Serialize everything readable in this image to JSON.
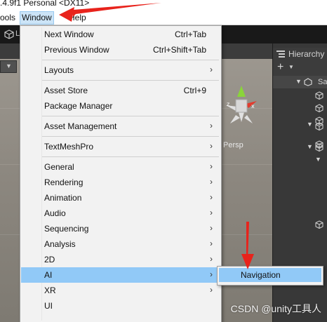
{
  "titlebar": {
    "text": ".4.9f1 Personal <DX11>"
  },
  "menubar": {
    "tools_label": "ools",
    "window_label": "Window",
    "help_label": "Help"
  },
  "editor": {
    "tab_label": "L",
    "scene_label": "Persp",
    "hierarchy_title": "Hierarchy",
    "hierarchy_plus": "+",
    "scene_row_label": "Sa"
  },
  "menu": {
    "items": [
      {
        "label": "Next Window",
        "shortcut": "Ctrl+Tab",
        "submenu": false
      },
      {
        "label": "Previous Window",
        "shortcut": "Ctrl+Shift+Tab",
        "submenu": false
      },
      {
        "label": "Layouts",
        "shortcut": "",
        "submenu": true
      },
      {
        "label": "Asset Store",
        "shortcut": "Ctrl+9",
        "submenu": false
      },
      {
        "label": "Package Manager",
        "shortcut": "",
        "submenu": false
      },
      {
        "label": "Asset Management",
        "shortcut": "",
        "submenu": true
      },
      {
        "label": "TextMeshPro",
        "shortcut": "",
        "submenu": true
      },
      {
        "label": "General",
        "shortcut": "",
        "submenu": true
      },
      {
        "label": "Rendering",
        "shortcut": "",
        "submenu": true
      },
      {
        "label": "Animation",
        "shortcut": "",
        "submenu": true
      },
      {
        "label": "Audio",
        "shortcut": "",
        "submenu": true
      },
      {
        "label": "Sequencing",
        "shortcut": "",
        "submenu": true
      },
      {
        "label": "Analysis",
        "shortcut": "",
        "submenu": true
      },
      {
        "label": "2D",
        "shortcut": "",
        "submenu": true
      },
      {
        "label": "AI",
        "shortcut": "",
        "submenu": true
      },
      {
        "label": "XR",
        "shortcut": "",
        "submenu": true
      },
      {
        "label": "UI",
        "shortcut": "",
        "submenu": false
      }
    ],
    "submenu_arrow": "›"
  },
  "submenu": {
    "item_label": "Navigation"
  },
  "watermark": {
    "text": "CSDN @unity工具人"
  },
  "colors": {
    "highlight": "#91c9f7",
    "menu_bg": "#f2f2f2",
    "annotation_red": "#e8231c",
    "editor_dark": "#191919"
  },
  "icons": {
    "toolbar": "unity-cube-icon",
    "hierarchy_tab": "hierarchy-list-icon",
    "hierarchy_objects": "gameobject-cube-icon",
    "scene_gizmo": "scene-orientation-gizmo-icon"
  }
}
